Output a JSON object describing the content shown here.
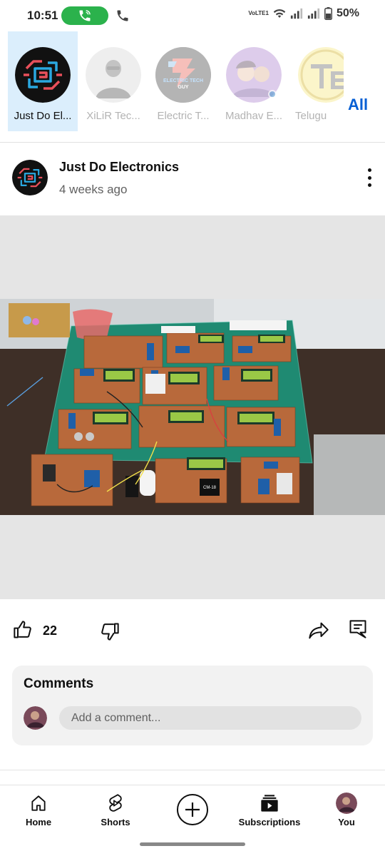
{
  "status_bar": {
    "time": "10:51",
    "volte_label": "VoLTE1",
    "battery": "50%"
  },
  "channels": [
    {
      "name": "Just Do El...",
      "selected": true
    },
    {
      "name": "XiLiR Tec..."
    },
    {
      "name": "Electric T..."
    },
    {
      "name": "Madhav E..."
    },
    {
      "name": "Telugu"
    }
  ],
  "channel_logos": {
    "electric_tech_line1": "ELECTRIC TECH",
    "electric_tech_line2": "GUY"
  },
  "all_label": "All",
  "post": {
    "channel": "Just Do Electronics",
    "time": "4 weeks ago",
    "likes": "22"
  },
  "comments": {
    "title": "Comments",
    "placeholder": "Add a comment..."
  },
  "photo_labels": {
    "module": "CM-18"
  },
  "nav": {
    "home": "Home",
    "shorts": "Shorts",
    "subscriptions": "Subscriptions",
    "you": "You"
  },
  "colors": {
    "accent_blue": "#065fd4",
    "call_green": "#2bb24c",
    "selected_bg": "#dbeefc",
    "logo_red": "#e8505b",
    "logo_cyan": "#2aa8e0"
  }
}
